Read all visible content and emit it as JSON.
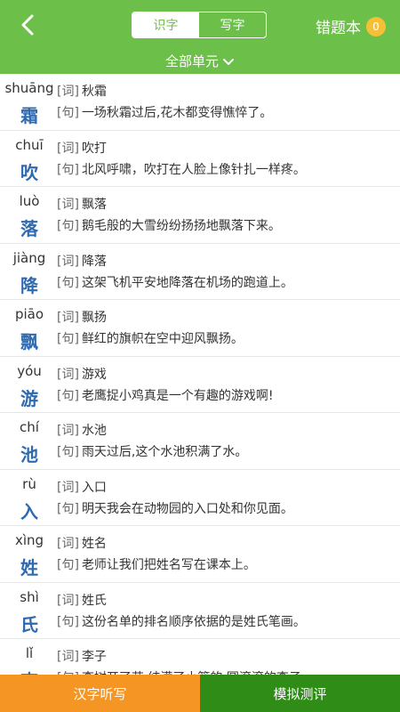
{
  "header": {
    "tabs": [
      {
        "label": "识字",
        "active": true
      },
      {
        "label": "写字",
        "active": false
      }
    ],
    "mistakes_label": "错题本",
    "mistakes_count": "0",
    "unit_label": "全部单元",
    "icons": {
      "back": "chevron-left-icon",
      "unit": "chevron-down-icon"
    },
    "colors": {
      "primary": "#6cc04a",
      "badge": "#f5c037"
    }
  },
  "list": {
    "word_tag": "[词]",
    "sentence_tag": "[句]",
    "items": [
      {
        "pinyin": "shuāng",
        "char": "霜",
        "word": "秋霜",
        "sentence": "一场秋霜过后,花木都变得憔悴了。"
      },
      {
        "pinyin": "chuī",
        "char": "吹",
        "word": "吹打",
        "sentence": "北风呼啸，吹打在人脸上像针扎一样疼。"
      },
      {
        "pinyin": "luò",
        "char": "落",
        "word": "飘落",
        "sentence": "鹅毛般的大雪纷纷扬扬地飘落下来。"
      },
      {
        "pinyin": "jiàng",
        "char": "降",
        "word": "降落",
        "sentence": "这架飞机平安地降落在机场的跑道上。"
      },
      {
        "pinyin": "piāo",
        "char": "飘",
        "word": "飘扬",
        "sentence": "鲜红的旗帜在空中迎风飘扬。"
      },
      {
        "pinyin": "yóu",
        "char": "游",
        "word": "游戏",
        "sentence": "老鹰捉小鸡真是一个有趣的游戏啊!"
      },
      {
        "pinyin": "chí",
        "char": "池",
        "word": "水池",
        "sentence": "雨天过后,这个水池积满了水。"
      },
      {
        "pinyin": "rù",
        "char": "入",
        "word": "入口",
        "sentence": "明天我会在动物园的入口处和你见面。"
      },
      {
        "pinyin": "xìng",
        "char": "姓",
        "word": "姓名",
        "sentence": "老师让我们把姓名写在课本上。"
      },
      {
        "pinyin": "shì",
        "char": "氏",
        "word": "姓氏",
        "sentence": "这份名单的排名顺序依据的是姓氏笔画。"
      },
      {
        "pinyin": "lǐ",
        "char": "李",
        "word": "李子",
        "sentence": "李树开了花,结满了小篮的,圆滚滚的李子。"
      }
    ]
  },
  "bottom": {
    "left_label": "汉字听写",
    "right_label": "模拟测评",
    "colors": {
      "left": "#f59524",
      "right": "#2e8c17"
    }
  }
}
